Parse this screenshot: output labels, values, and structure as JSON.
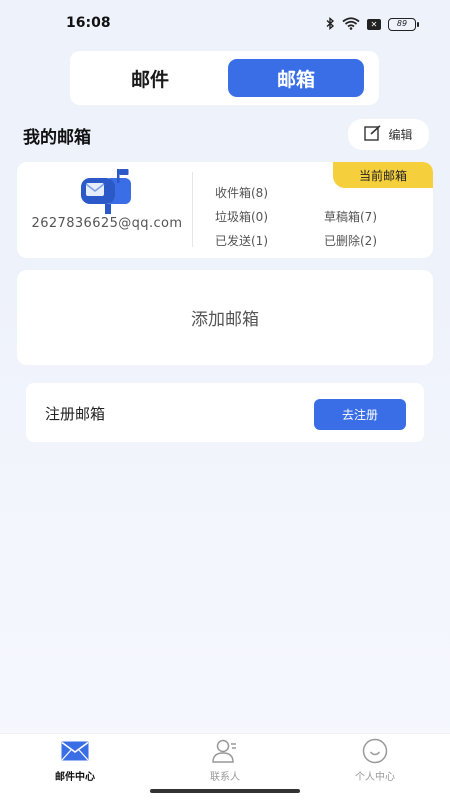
{
  "status_bar": {
    "time": "16:08",
    "battery": "89",
    "sim": "✕"
  },
  "segment": {
    "tab_mail": "邮件",
    "tab_mailbox": "邮箱"
  },
  "section": {
    "title": "我的邮箱",
    "edit_label": "编辑"
  },
  "mailbox_card": {
    "badge": "当前邮箱",
    "address": "2627836625@qq.com",
    "inbox": "收件箱(8)",
    "spam": "垃圾箱(0)",
    "drafts": "草稿箱(7)",
    "sent": "已发送(1)",
    "deleted": "已删除(2)"
  },
  "add_mailbox": {
    "label": "添加邮箱"
  },
  "register": {
    "label": "注册邮箱",
    "button": "去注册"
  },
  "bottom_nav": {
    "mail_center": "邮件中心",
    "contacts": "联系人",
    "profile": "个人中心"
  },
  "colors": {
    "accent": "#3a6ee6",
    "badge": "#f6cf3c"
  }
}
